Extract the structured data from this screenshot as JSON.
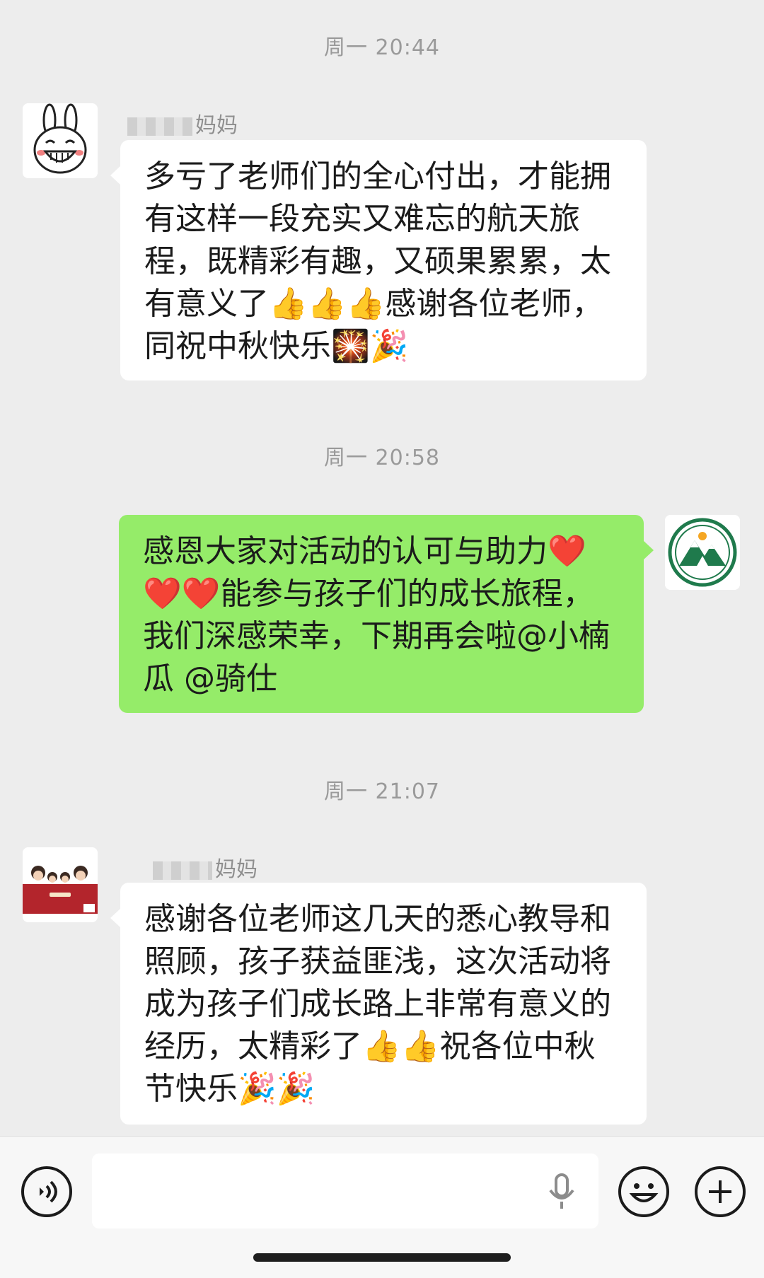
{
  "messages": [
    {
      "timestamp": "周一 20:44",
      "side": "left",
      "sender": "妈妈",
      "avatar_icon": "rabbit-avatar-icon",
      "text": "多亏了老师们的全心付出，才能拥有这样一段充实又难忘的航天旅程，既精彩有趣，又硕果累累，太有意义了👍👍👍感谢各位老师，同祝中秋快乐🎇🎉"
    },
    {
      "timestamp": "周一 20:58",
      "side": "right",
      "avatar_icon": "mountain-tent-logo-icon",
      "text": "感恩大家对活动的认可与助力❤️❤️❤️能参与孩子们的成长旅程，我们深感荣幸，下期再会啦@小楠瓜 @骑仕"
    },
    {
      "timestamp": "周一 21:07",
      "side": "left",
      "sender": "妈妈",
      "avatar_icon": "family-photo-avatar-icon",
      "text": "感谢各位老师这几天的悉心教导和照顾，孩子获益匪浅，这次活动将成为孩子们成长路上非常有意义的经历，太精彩了👍👍祝各位中秋节快乐🎉🎉"
    }
  ],
  "input_bar": {
    "voice_icon": "voice-icon",
    "mic_icon": "microphone-icon",
    "emoji_icon": "emoji-icon",
    "plus_icon": "plus-icon",
    "input_value": ""
  },
  "colors": {
    "background": "#ededed",
    "incoming_bubble": "#ffffff",
    "outgoing_bubble": "#95ec69",
    "timestamp": "#9a9a9a"
  }
}
